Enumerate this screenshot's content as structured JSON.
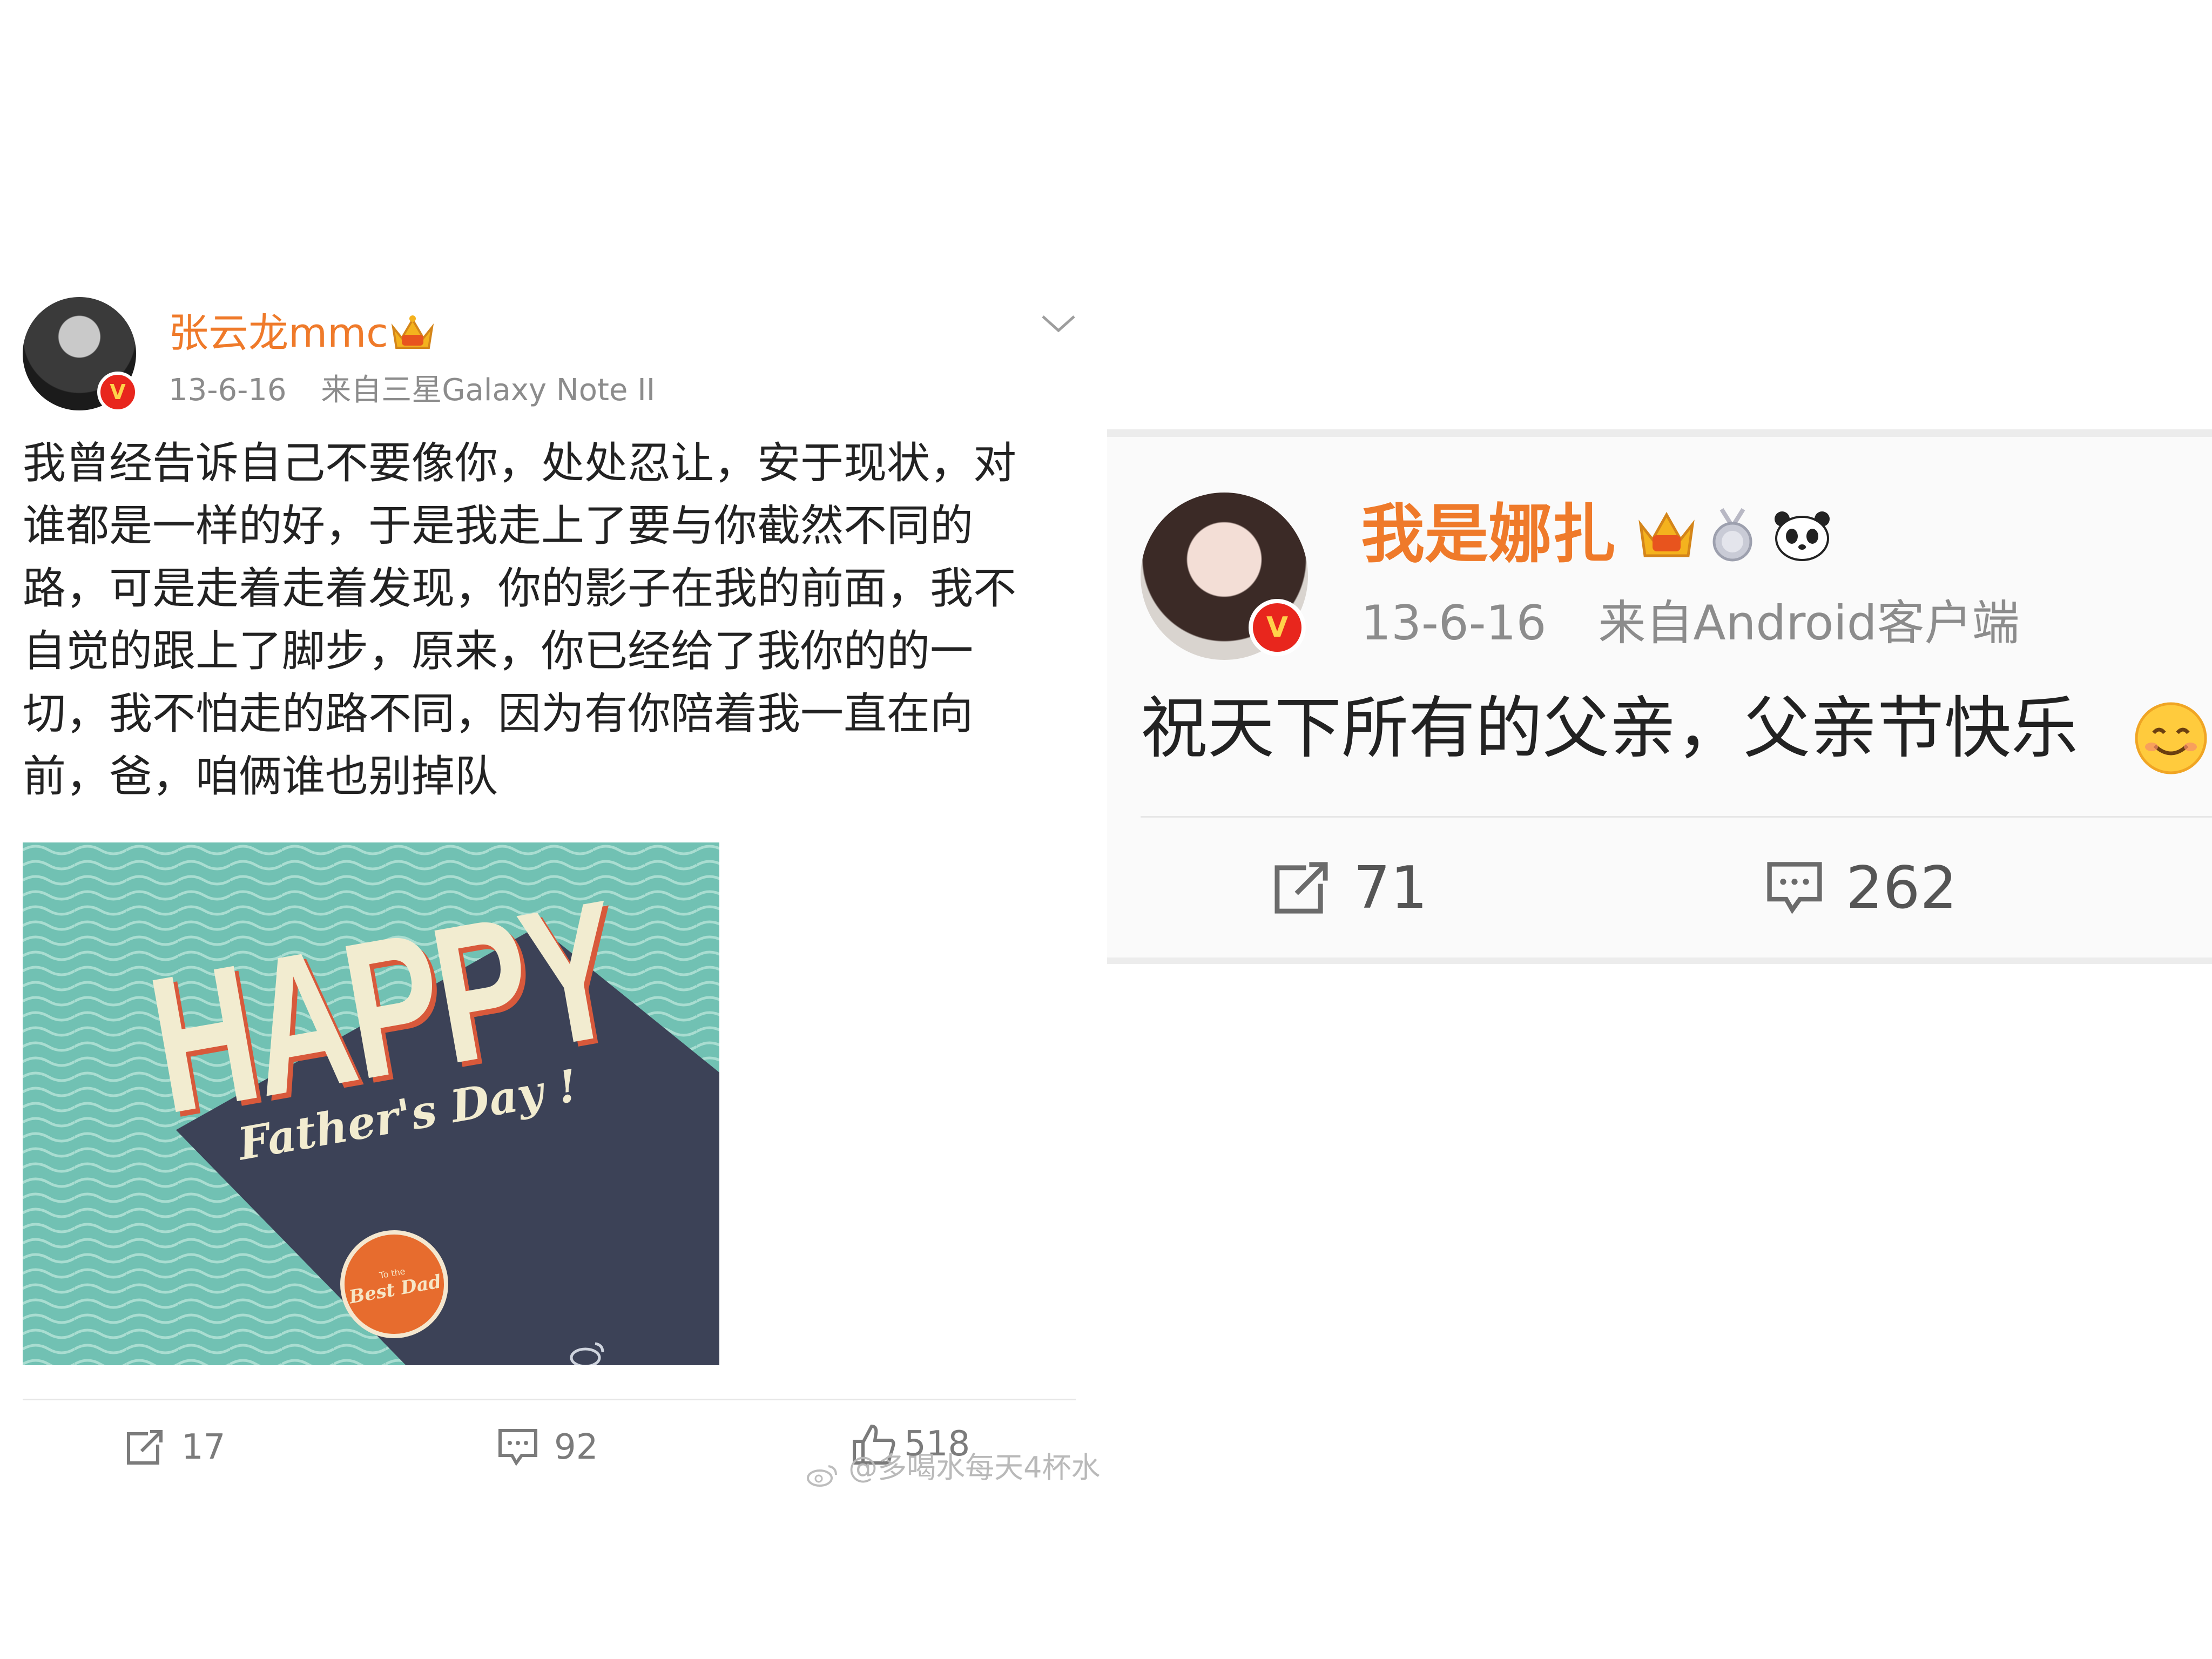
{
  "left_post": {
    "username": "张云龙mmc",
    "date": "13-6-16",
    "source": "来自三星Galaxy Note II",
    "text_lines": [
      "我曾经告诉自己不要像你，处处忍让，安于现状，对",
      "谁都是一样的好，于是我走上了要与你截然不同的",
      "路，可是走着走着发现，你的影子在我的前面，我不",
      "自觉的跟上了脚步，原来，你已经给了我你的的一",
      "切，我不怕走的路不同，因为有你陪着我一直在向",
      "前，爸，咱俩谁也别掉队"
    ],
    "image": {
      "title": "HAPPY",
      "subtitle": "Father's Day !",
      "seal_small": "To the",
      "seal_big": "Best Dad"
    },
    "actions": {
      "repost_count": "17",
      "comment_count": "92",
      "like_count": "518"
    }
  },
  "right_post": {
    "username": "我是娜扎",
    "date": "13-6-16",
    "source": "来自Android客户端",
    "text": "祝天下所有的父亲，父亲节快乐",
    "actions": {
      "repost_count": "71",
      "comment_count": "262"
    }
  },
  "watermark": "@多喝水每天4杯水",
  "badge_letter": "V",
  "colors": {
    "username": "#ef7a2a",
    "verified_badge": "#e8261d",
    "meta_text": "#8c8c8c",
    "card_teal": "#71c1b3",
    "card_navy": "#3c4257",
    "card_orange": "#e76c2e"
  }
}
